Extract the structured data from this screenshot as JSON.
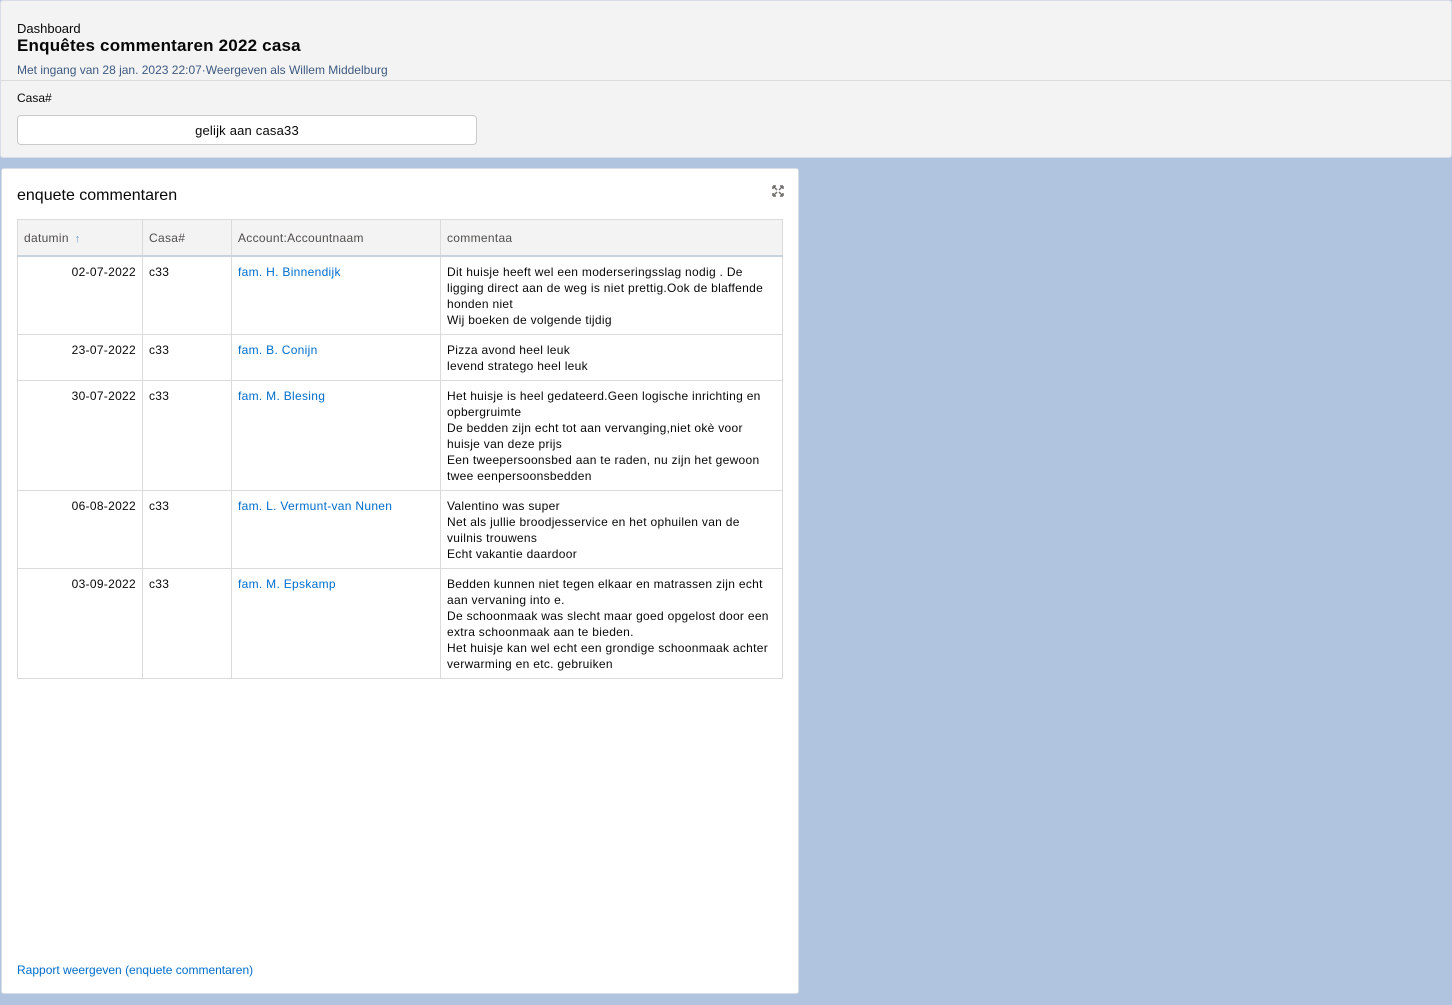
{
  "header": {
    "label": "Dashboard",
    "title": "Enquêtes commentaren 2022 casa",
    "subtitle": "Met ingang van 28 jan. 2023 22:07·Weergeven als Willem Middelburg",
    "filter": {
      "label": "Casa#",
      "value": "gelijk aan casa33"
    }
  },
  "card": {
    "title": "enquete commentaren",
    "expand_icon": "expand-icon",
    "columns": [
      "datumin",
      "Casa#",
      "Account:Accountnaam",
      "commentaa"
    ],
    "sort_icon": "arrow-up-icon",
    "rows": [
      {
        "date": "02-07-2022",
        "casa": "c33",
        "account": "fam. H. Binnendijk",
        "comment": [
          "Dit huisje heeft wel een moderseringsslag nodig . De ligging direct aan de weg is niet prettig.Ook de blaffende honden niet",
          "Wij boeken de volgende tijdig"
        ]
      },
      {
        "date": "23-07-2022",
        "casa": "c33",
        "account": "fam. B. Conijn",
        "comment": [
          "Pizza avond heel leuk",
          "levend stratego heel leuk"
        ]
      },
      {
        "date": "30-07-2022",
        "casa": "c33",
        "account": "fam. M. Blesing",
        "comment": [
          "Het huisje is heel gedateerd.Geen logische inrichting en opbergruimte",
          "De bedden zijn echt tot aan vervanging,niet okè voor huisje van deze prijs",
          "Een tweepersoonsbed aan te raden, nu zijn het gewoon twee eenpersoonsbedden"
        ]
      },
      {
        "date": "06-08-2022",
        "casa": "c33",
        "account": "fam. L. Vermunt-van Nunen",
        "comment": [
          "Valentino was super",
          "Net als jullie broodjesservice en het ophuilen van de vuilnis trouwens",
          "Echt vakantie daardoor"
        ]
      },
      {
        "date": "03-09-2022",
        "casa": "c33",
        "account": "fam. M. Epskamp",
        "comment": [
          "Bedden kunnen niet tegen elkaar en matrassen zijn echt aan vervaning into e.",
          "De schoonmaak was slecht maar goed opgelost door een extra schoonmaak aan te bieden.",
          "Het huisje kan wel echt een grondige schoonmaak achter verwarming en etc. gebruiken"
        ]
      }
    ],
    "report_link": "Rapport weergeven (enquete commentaren)"
  }
}
